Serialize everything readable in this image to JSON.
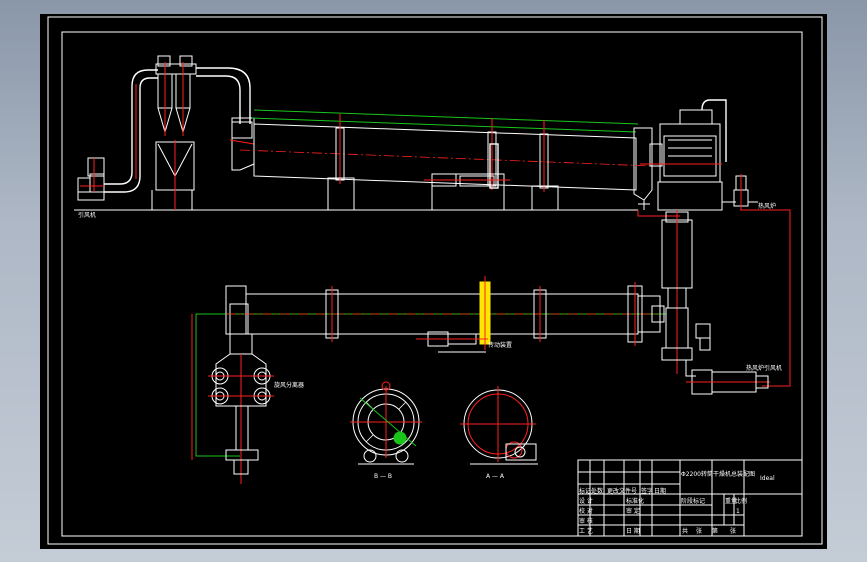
{
  "drawing": {
    "labels": {
      "induced_fan": "引风机",
      "hot_air_furnace": "热风炉",
      "transmission": "传动装置",
      "cyclone_separator": "旋风分离器",
      "hot_blast_stove_fan": "热风炉引风机",
      "section_b": "B — B",
      "section_a": "A — A"
    },
    "title_block": {
      "drawing_title": "Φ2200转筒干燥机总装配图",
      "row_labels": [
        "设 计",
        "校 对",
        "审 核",
        "工 艺"
      ],
      "header_cells": [
        "标记",
        "处数",
        "更改文件号",
        "签字",
        "日期"
      ],
      "sign_cells": [
        "标准化",
        "审 定"
      ],
      "date_cell": "日 期",
      "stage_header": [
        "阶段标记",
        "重量",
        "比例"
      ],
      "scale": "1",
      "sheet_info": [
        "共",
        "张",
        "第",
        "张"
      ],
      "company": "Ideal"
    },
    "colors": {
      "background": "#000000",
      "outline": "#ffffff",
      "centerline": "#ff2020",
      "hidden": "#19c519",
      "highlight": "#ffe600"
    }
  }
}
